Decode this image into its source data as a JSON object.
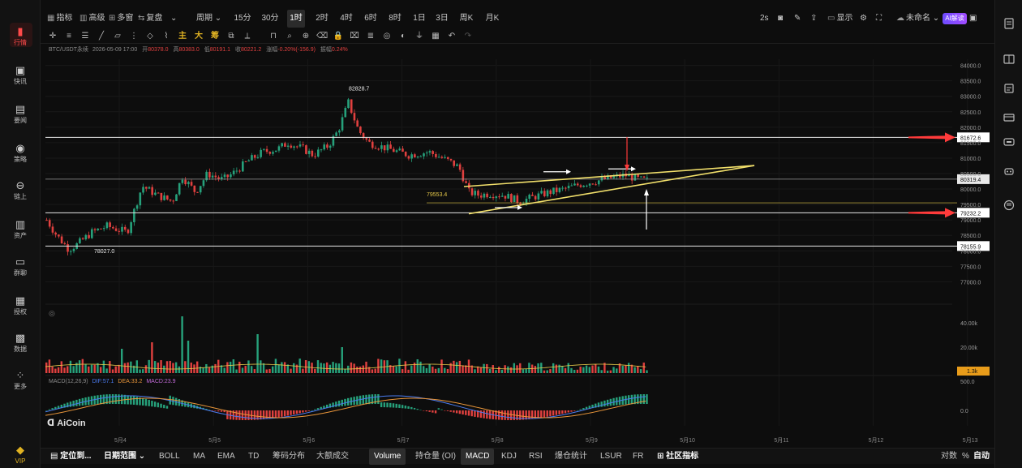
{
  "nav": [
    {
      "label": "行情",
      "icon": "chart-bar-icon",
      "active": true
    },
    {
      "label": "快讯",
      "icon": "news-flash-icon"
    },
    {
      "label": "要闻",
      "icon": "document-icon"
    },
    {
      "label": "策略",
      "icon": "robot-icon"
    },
    {
      "label": "链上",
      "icon": "chain-icon"
    },
    {
      "label": "资产",
      "icon": "wallet-icon"
    },
    {
      "label": "群聊",
      "icon": "chat-icon"
    },
    {
      "label": "授权",
      "icon": "authorize-icon"
    },
    {
      "label": "数据",
      "icon": "data-icon"
    },
    {
      "label": "更多",
      "icon": "grid-more-icon"
    },
    {
      "label": "VIP",
      "icon": "diamond-icon"
    }
  ],
  "topbar": {
    "indicators": "指标",
    "advanced": "高级",
    "multi_window": "多窗",
    "replay": "复盘",
    "period": "周期",
    "timeframes": [
      "15分",
      "30分",
      "1时",
      "2时",
      "4时",
      "6时",
      "8时",
      "1日",
      "3日",
      "周K",
      "月K"
    ],
    "selected_timeframe": "1时",
    "refresh": "2s",
    "display": "显示",
    "unnamed": "未命名",
    "ai_badge": "AI解读"
  },
  "drawing_tools": {
    "yellow_labels": [
      "主",
      "大",
      "筹"
    ]
  },
  "chart_data": {
    "type": "candlestick",
    "symbol_info": {
      "pair": "BTC/USDT永续",
      "datetime": "2026-05-09 17:00",
      "open_label": "开",
      "open": "80378.0",
      "high_label": "高",
      "high": "80383.0",
      "low_label": "低",
      "low": "80191.1",
      "close_label": "收",
      "close": "80221.2",
      "change_label": "涨幅",
      "change": "-0.20%(-156.9)",
      "amp_label": "振幅",
      "amp": "0.24%"
    },
    "y_axis": {
      "ticks": [
        "84000.0",
        "83500.0",
        "83000.0",
        "82500.0",
        "82000.0",
        "81500.0",
        "81000.0",
        "80500.0",
        "80000.0",
        "79500.0",
        "79000.0",
        "78500.0",
        "78000.0",
        "77500.0",
        "77000.0"
      ],
      "range": [
        76800,
        84200
      ]
    },
    "x_axis": {
      "ticks": [
        "5月4",
        "5月5",
        "5月6",
        "5月7",
        "5月8",
        "5月9",
        "5月10",
        "5月11",
        "5月12",
        "5月13"
      ]
    },
    "horizontal_levels": [
      {
        "price": 81672.6,
        "label": "81672.6",
        "style": "white-box"
      },
      {
        "price": 80319.4,
        "label": "80319.4",
        "style": "current"
      },
      {
        "price": 79232.2,
        "label": "79232.2",
        "style": "white-box"
      },
      {
        "price": 78155.9,
        "label": "78155.9",
        "style": "white-box"
      }
    ],
    "annotations": {
      "high": "82828.7",
      "low": "78027.0",
      "level_79553": "79553.4"
    },
    "volume": {
      "title": "Volume",
      "ticks": [
        "40.00k",
        "20.00k"
      ],
      "current": "1.3k"
    },
    "macd": {
      "name": "MACD(12,26,9)",
      "dif_label": "DIF:",
      "dif": "57.1",
      "dea_label": "DEA:",
      "dea": "33.2",
      "macd_label": "MACD:",
      "macd": "23.9",
      "ticks": [
        "500.0",
        "0.0"
      ]
    },
    "watermark": "AiCoin"
  },
  "bottombar": {
    "locate": "定位到...",
    "date_range": "日期范围",
    "indicators": [
      "BOLL",
      "MA",
      "EMA",
      "TD",
      "筹码分布",
      "大额成交"
    ],
    "sub_indicators": [
      "Volume",
      "持仓量 (OI)",
      "MACD",
      "KDJ",
      "RSI",
      "爆仓统计",
      "LSUR",
      "FR"
    ],
    "selected": [
      "Volume",
      "MACD"
    ],
    "community": "社区指标",
    "log": "对数",
    "percent": "%",
    "auto": "自动"
  },
  "colors": {
    "up": "#26a17b",
    "down": "#e0403f",
    "accent_red": "#ff3b3b",
    "wedge": "#f1df6b",
    "ai_badge": "#7b4bff"
  }
}
